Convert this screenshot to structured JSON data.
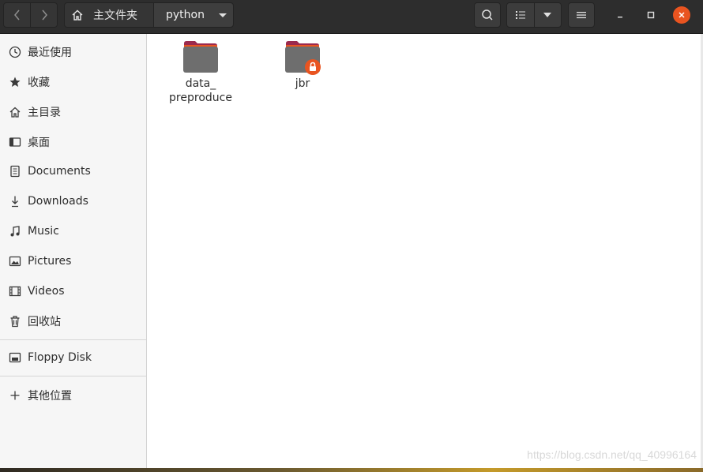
{
  "header": {
    "breadcrumb_home": "主文件夹",
    "breadcrumb_current": "python"
  },
  "sidebar": {
    "items": [
      {
        "label": "最近使用",
        "icon": "clock-icon"
      },
      {
        "label": "收藏",
        "icon": "star-icon"
      },
      {
        "label": "主目录",
        "icon": "home-icon"
      },
      {
        "label": "桌面",
        "icon": "desktop-icon"
      },
      {
        "label": "Documents",
        "icon": "document-icon"
      },
      {
        "label": "Downloads",
        "icon": "download-icon"
      },
      {
        "label": "Music",
        "icon": "music-icon"
      },
      {
        "label": "Pictures",
        "icon": "picture-icon"
      },
      {
        "label": "Videos",
        "icon": "video-icon"
      },
      {
        "label": "回收站",
        "icon": "trash-icon"
      }
    ],
    "devices": [
      {
        "label": "Floppy Disk",
        "icon": "disk-icon"
      }
    ],
    "other": {
      "label": "其他位置",
      "icon": "plus-icon"
    }
  },
  "files": [
    {
      "name_line1": "data_",
      "name_line2": "preproduce",
      "locked": false
    },
    {
      "name_line1": "jbr",
      "name_line2": "",
      "locked": true
    }
  ],
  "watermark": "https://blog.csdn.net/qq_40996164",
  "colors": {
    "headerbar": "#2d2d2d",
    "folder_body": "#6e6e6e",
    "folder_tab": "#9b2a4e",
    "folder_accent": "#e95420",
    "close_button": "#e95420"
  }
}
